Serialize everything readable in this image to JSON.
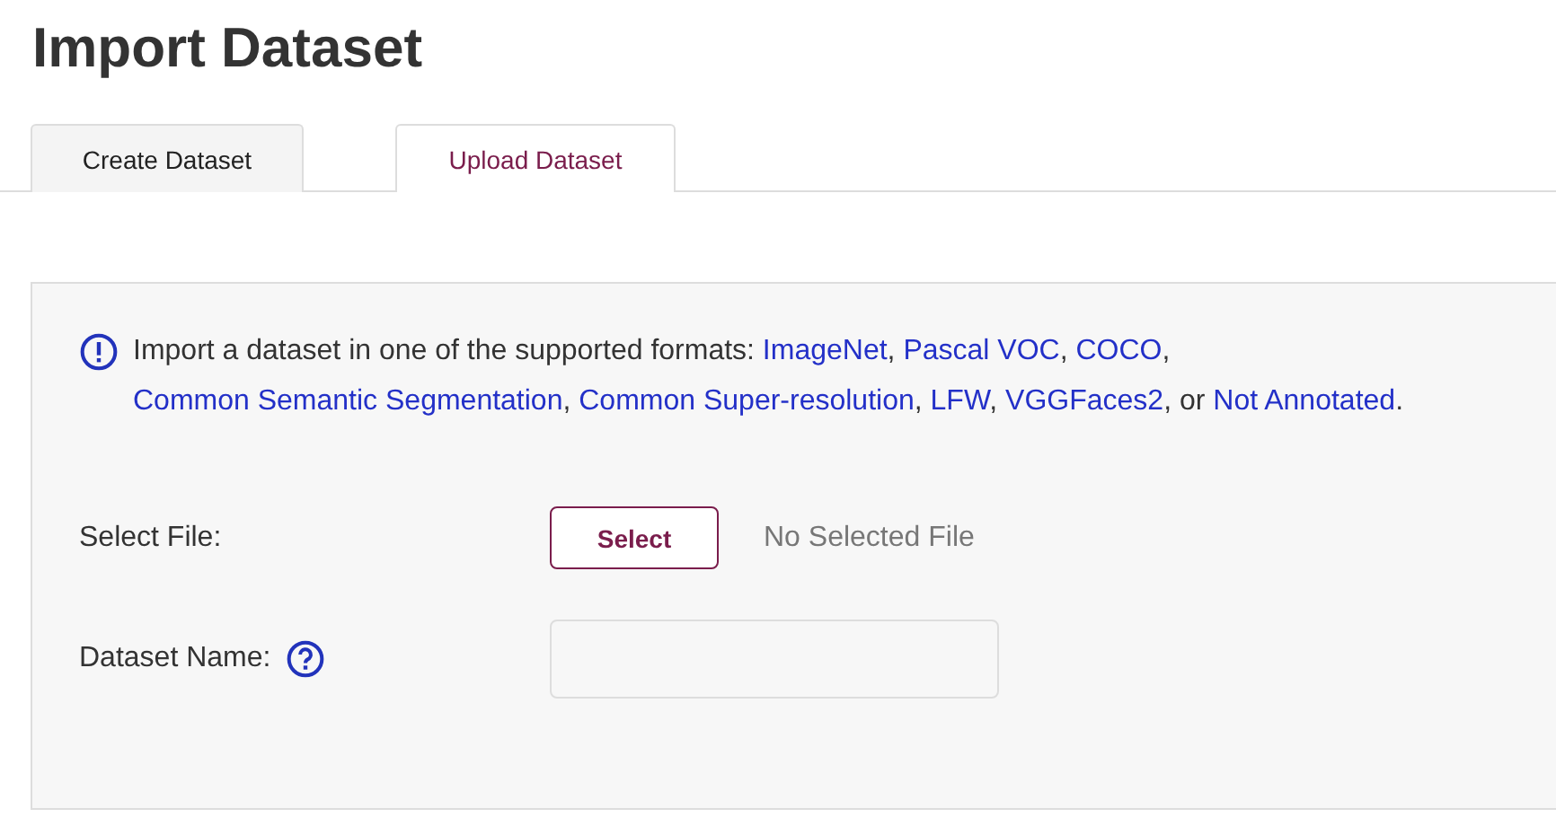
{
  "page_title": "Import Dataset",
  "tabs": [
    {
      "label": "Create Dataset",
      "selected": false
    },
    {
      "label": "Upload Dataset",
      "selected": true
    }
  ],
  "info": {
    "parts": [
      {
        "kind": "text",
        "text": "Import a dataset in one of the supported formats: "
      },
      {
        "kind": "link",
        "text": "ImageNet"
      },
      {
        "kind": "text",
        "text": ", "
      },
      {
        "kind": "link",
        "text": "Pascal VOC"
      },
      {
        "kind": "text",
        "text": ", "
      },
      {
        "kind": "link",
        "text": "COCO"
      },
      {
        "kind": "text",
        "text": ", "
      },
      {
        "kind": "link",
        "text": "Common Semantic Segmentation"
      },
      {
        "kind": "text",
        "text": ", "
      },
      {
        "kind": "link",
        "text": "Common Super-resolution"
      },
      {
        "kind": "text",
        "text": ", "
      },
      {
        "kind": "link",
        "text": "LFW"
      },
      {
        "kind": "text",
        "text": ", "
      },
      {
        "kind": "link",
        "text": "VGGFaces2"
      },
      {
        "kind": "text",
        "text": ", or "
      },
      {
        "kind": "link",
        "text": "Not Annotated"
      },
      {
        "kind": "text",
        "text": "."
      }
    ]
  },
  "select_file": {
    "label": "Select File:",
    "button": "Select",
    "status": "No Selected File"
  },
  "dataset_name": {
    "label": "Dataset Name:"
  }
}
